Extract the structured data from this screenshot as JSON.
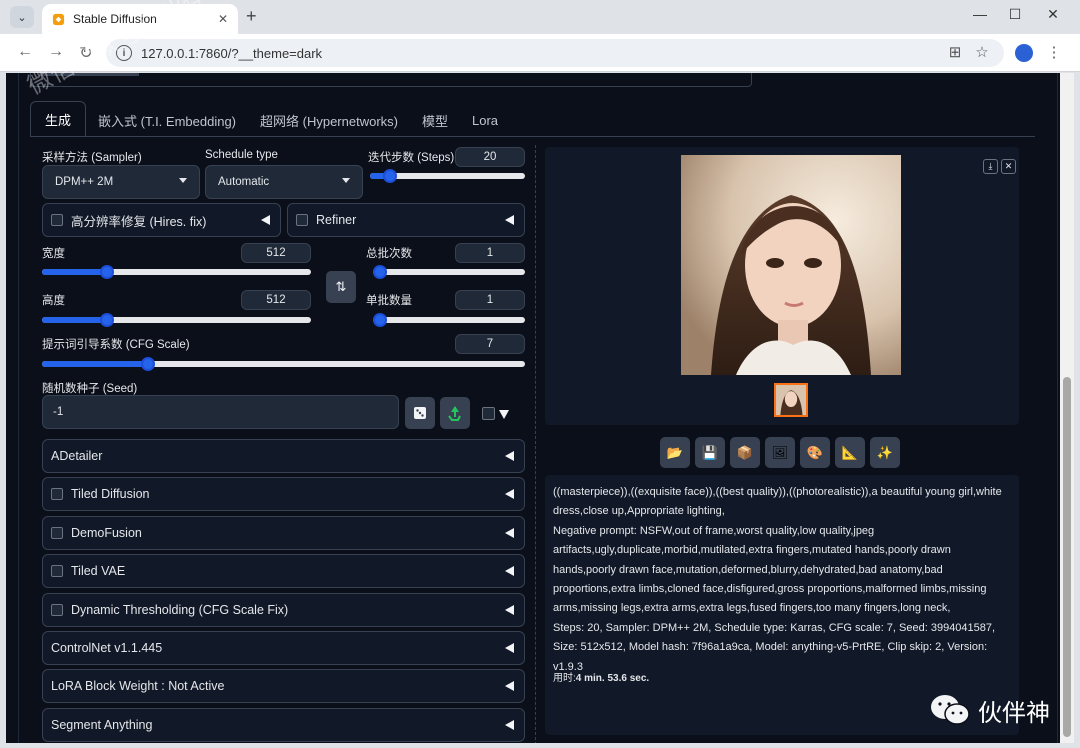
{
  "browser": {
    "tab_title": "Stable Diffusion",
    "url": "127.0.0.1:7860/?__theme=dark"
  },
  "tabs": [
    "生成",
    "嵌入式 (T.I. Embedding)",
    "超网络 (Hypernetworks)",
    "模型",
    "Lora"
  ],
  "left": {
    "sampler_label": "采样方法 (Sampler)",
    "sampler_value": "DPM++ 2M",
    "schedule_label": "Schedule type",
    "schedule_value": "Automatic",
    "steps_label": "迭代步数 (Steps)",
    "steps_value": "20",
    "hires_label": "高分辨率修复 (Hires. fix)",
    "refiner_label": "Refiner",
    "width_label": "宽度",
    "width_value": "512",
    "batch_count_label": "总批次数",
    "batch_count_value": "1",
    "height_label": "高度",
    "height_value": "512",
    "batch_size_label": "单批数量",
    "batch_size_value": "1",
    "cfg_label": "提示词引导系数 (CFG Scale)",
    "cfg_value": "7",
    "seed_label": "随机数种子 (Seed)",
    "seed_value": "-1",
    "swap_icon": "⇅"
  },
  "sliders": {
    "steps": 0.13,
    "width": 0.24,
    "batch_count": 0.0,
    "height": 0.24,
    "batch_size": 0.0,
    "cfg": 0.22
  },
  "accordions": [
    {
      "label": "ADetailer",
      "checkbox": false
    },
    {
      "label": "Tiled Diffusion",
      "checkbox": true
    },
    {
      "label": "DemoFusion",
      "checkbox": true
    },
    {
      "label": "Tiled VAE",
      "checkbox": true
    },
    {
      "label": "Dynamic Thresholding (CFG Scale Fix)",
      "checkbox": true
    },
    {
      "label": "ControlNet v1.1.445",
      "checkbox": false
    },
    {
      "label": "LoRA Block Weight : Not Active",
      "checkbox": false
    },
    {
      "label": "Segment Anything",
      "checkbox": false
    }
  ],
  "info": {
    "prompt": "((masterpiece)),((exquisite face)),((best quality)),((photorealistic)),a beautiful young girl,white dress,close up,Appropriate lighting,",
    "negative": "Negative prompt: NSFW,out of frame,worst quality,low quality,jpeg artifacts,ugly,duplicate,morbid,mutilated,extra fingers,mutated hands,poorly drawn hands,poorly drawn face,mutation,deformed,blurry,dehydrated,bad anatomy,bad proportions,extra limbs,cloned face,disfigured,gross proportions,malformed limbs,missing arms,missing legs,extra arms,extra legs,fused fingers,too many fingers,long neck,",
    "params": "Steps: 20, Sampler: DPM++ 2M, Schedule type: Karras, CFG scale: 7, Seed: 3994041587, Size: 512x512, Model hash: 7f96a1a9ca, Model: anything-v5-PrtRE, Clip skip: 2, Version: v1.9.3",
    "time_label": "用时:",
    "time_value": "4 min. 53.6 sec."
  },
  "watermark": {
    "diagonal": "微信公众号：伙伴神",
    "logo": "伙伴神"
  },
  "colors": {
    "bg": "#0b0f19",
    "panel": "#1f2937",
    "accent": "#2563eb",
    "thumb_border": "#f97316"
  }
}
